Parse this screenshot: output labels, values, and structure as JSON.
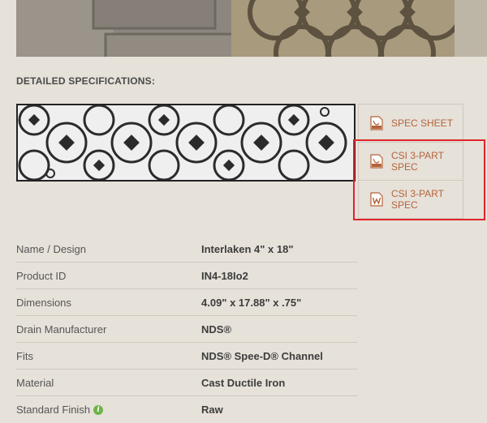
{
  "section_heading": "DETAILED SPECIFICATIONS:",
  "downloads": [
    {
      "label": "SPEC SHEET",
      "icon": "pdf-file-icon"
    },
    {
      "label": "CSI 3-PART SPEC",
      "icon": "pdf-file-icon"
    },
    {
      "label": "CSI 3-PART SPEC",
      "icon": "word-file-icon"
    }
  ],
  "specs": [
    {
      "label": "Name / Design",
      "value": "Interlaken 4\" x 18\""
    },
    {
      "label": "Product ID",
      "value": "IN4-18Io2"
    },
    {
      "label": "Dimensions",
      "value": "4.09\" x 17.88\" x .75\""
    },
    {
      "label": "Drain Manufacturer",
      "value": "NDS®"
    },
    {
      "label": "Fits",
      "value": "NDS® Spee-D® Channel"
    },
    {
      "label": "Material",
      "value": "Cast Ductile Iron"
    },
    {
      "label": "Standard Finish",
      "value": "Raw"
    }
  ],
  "colors": {
    "link": "#b4643b",
    "highlight": "#e0242a",
    "info": "#6fb34a"
  }
}
